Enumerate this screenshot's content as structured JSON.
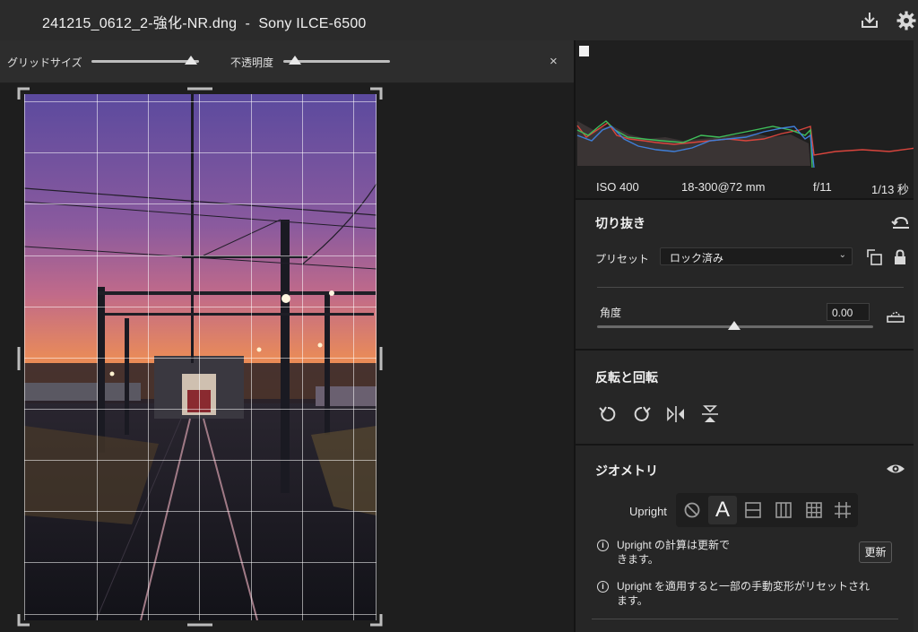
{
  "titlebar": {
    "filename": "241215_0612_2-強化-NR.dng",
    "separator": "-",
    "camera": "Sony ILCE-6500",
    "icons": [
      "save-download-icon",
      "gear-icon"
    ]
  },
  "overlay_bar": {
    "grid_size_label": "グリッドサイズ",
    "grid_size_value": 0.9,
    "opacity_label": "不透明度",
    "opacity_value": 0.1,
    "close_glyph": "×"
  },
  "exif": {
    "iso": "ISO 400",
    "lens": "18-300@72 mm",
    "aperture": "f/11",
    "shutter": "1/13 秒"
  },
  "crop": {
    "title": "切り抜き",
    "preset_label": "プリセット",
    "preset_value": "ロック済み",
    "angle_label": "角度",
    "angle_value": "0.00",
    "angle_slider_value": 0.5
  },
  "flip_rotate": {
    "title": "反転と回転"
  },
  "geometry": {
    "title": "ジオメトリ",
    "upright_label": "Upright",
    "upright_modes": [
      "off",
      "auto",
      "level",
      "vertical",
      "full",
      "guided"
    ],
    "active_mode": "auto",
    "auto_glyph": "A",
    "info1_line1": "Upright の計算は更新で",
    "info1_line2": "きます。",
    "update_button": "更新",
    "info2_line1": "Upright を適用すると一部の手動変形がリセットされ",
    "info2_line2": "ます。",
    "info_glyph": "i"
  },
  "colors": {
    "histogram_red": "#d9453d",
    "histogram_green": "#3fbf5a",
    "histogram_blue": "#3f7fd9"
  }
}
